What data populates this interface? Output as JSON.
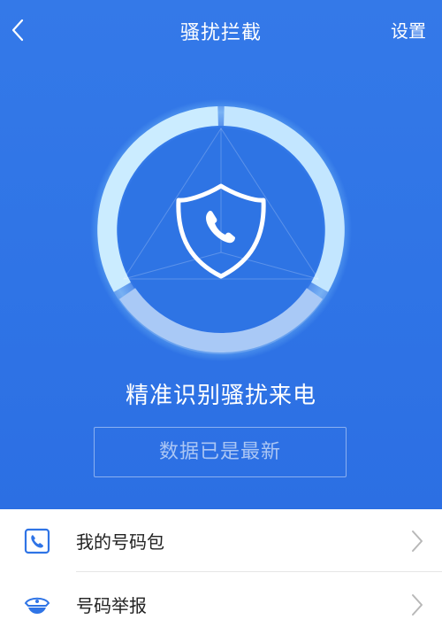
{
  "nav": {
    "title": "骚扰拦截",
    "settings_label": "设置",
    "back_icon": "chevron-left-icon"
  },
  "hero": {
    "headline": "精准识别骚扰来电",
    "status": "数据已是最新",
    "shield_icon": "shield-phone-icon"
  },
  "list": {
    "items": [
      {
        "label": "我的号码包",
        "icon": "phone-book-icon"
      },
      {
        "label": "号码举报",
        "icon": "police-cap-icon"
      }
    ]
  },
  "colors": {
    "primary": "#2f74e6",
    "ring": "#bfe3ff",
    "list_icon": "#2f74e6"
  }
}
